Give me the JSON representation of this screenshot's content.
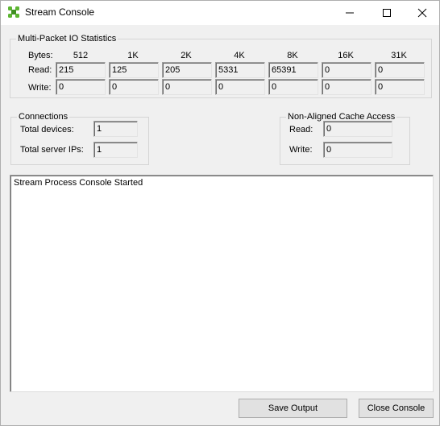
{
  "window": {
    "title": "Stream Console",
    "icon": "app-grid-icon"
  },
  "controls": {
    "minimize": "minimize-icon",
    "maximize": "maximize-icon",
    "close": "close-icon"
  },
  "stats": {
    "title": "Multi-Packet IO Statistics",
    "bytes_label": "Bytes:",
    "read_label": "Read:",
    "write_label": "Write:",
    "columns": [
      "512",
      "1K",
      "2K",
      "4K",
      "8K",
      "16K",
      "31K"
    ],
    "read": [
      "215",
      "125",
      "205",
      "5331",
      "65391",
      "0",
      "0"
    ],
    "write": [
      "0",
      "0",
      "0",
      "0",
      "0",
      "0",
      "0"
    ]
  },
  "connections": {
    "title": "Connections",
    "total_devices_label": "Total devices:",
    "total_devices": "1",
    "total_server_ips_label": "Total server IPs:",
    "total_server_ips": "1"
  },
  "cache": {
    "title": "Non-Aligned Cache Access",
    "read_label": "Read:",
    "read": "0",
    "write_label": "Write:",
    "write": "0"
  },
  "console": {
    "text": "Stream Process Console Started"
  },
  "buttons": {
    "save_output": "Save Output",
    "close_console": "Close Console"
  },
  "colors": {
    "titlebar": "#ffffff",
    "face": "#f0f0f0",
    "icon_green": "#5cb531"
  }
}
